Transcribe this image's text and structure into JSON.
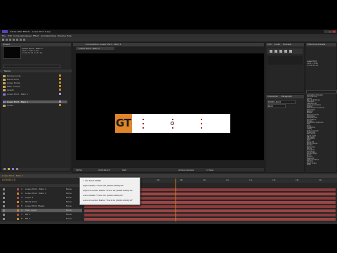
{
  "window": {
    "title": "Adobe After Effects - Lower third 1.aep",
    "controls": [
      "–",
      "□",
      "×"
    ]
  },
  "menu": [
    "File",
    "Edit",
    "Composition",
    "Layer",
    "Effect",
    "Animation",
    "View",
    "Window",
    "Help"
  ],
  "project": {
    "tab": "Project",
    "comp_name": "Lower third - Main 1",
    "comp_info": "1920 x 1080 (1.00)",
    "comp_info2": "Δ 0:00:10:00, 29.97 fps",
    "header": "Name",
    "items": [
      {
        "label": "Backgrounds",
        "selected": false
      },
      {
        "label": "Blank Solid",
        "selected": false
      },
      {
        "label": "Lower thirds",
        "selected": false
      },
      {
        "label": "Main Comps",
        "selected": false
      },
      {
        "label": "Assets",
        "selected": false
      },
      {
        "label": "Lower third - Main 1",
        "selected": false
      },
      {
        "label": "Lower third - Main 1",
        "selected": true
      },
      {
        "label": "Solids",
        "selected": false
      }
    ]
  },
  "composition": {
    "tab": "Composition: Lower third - Main 1",
    "breadcrumb": "Lower third - Main 1",
    "logo_text": "GT",
    "zoom": "(50%)",
    "timecode": "0:00:04:15",
    "resolution": "Half",
    "camera": "Active Camera",
    "view": "1 View"
  },
  "info_panel": {
    "tabs": [
      "Info",
      "Audio",
      "Preview"
    ],
    "label": "Preview"
  },
  "character": {
    "tab": "Character",
    "font": "DINPro-Bold",
    "style": "Bold"
  },
  "paragraph": {
    "tab": "Paragraph"
  },
  "effects": {
    "tab": "Effects & Presets",
    "items": [
      "Animation Presets",
      "3D Channel",
      "Audio",
      "Blur & Sharpen",
      "Channel",
      "CINEMA 4D",
      "Color Correction",
      "Distort",
      "Expression Controls",
      "Generate",
      "Keying",
      "Matte",
      "Noise & Grain",
      "Obsolete",
      "Perspective",
      "Simulation",
      "Stylize",
      "Synthetic Aperture",
      "Text",
      "Time",
      "Transition",
      "Utility",
      "Video Copilot",
      "Trapcode",
      "Red Giant",
      "Knoll Light",
      "RE:Vision",
      "Sapphire",
      "BCC",
      "Boris FX",
      "Magic Bullet",
      "Mocha",
      "Particular",
      "Shine",
      "Starglow",
      "3D Stroke",
      "Sound Keys",
      "Form",
      "Plexus",
      "Element",
      "Optical Flares",
      "Twixtor",
      "Neat Video",
      "Duik"
    ]
  },
  "right_info": {
    "line1": "Lower third",
    "line2": "1920 x 1080",
    "line3": "Δ 0:00:10:00"
  },
  "timeline": {
    "tab": "Lower third - Main 1",
    "timecode": "0:00:04:15",
    "search": "",
    "layers": [
      {
        "num": "1",
        "name": "Lower third - Main 1",
        "parent": "None"
      },
      {
        "num": "2",
        "name": "Lower third - Main 1",
        "parent": "None"
      },
      {
        "num": "3",
        "name": "Layer 3",
        "parent": "None"
      },
      {
        "num": "4",
        "name": "Blank Solid",
        "parent": "None"
      },
      {
        "num": "5",
        "name": "Lower third Shape",
        "parent": "None"
      },
      {
        "num": "6",
        "name": "Main Layer",
        "parent": "None",
        "selected": true
      },
      {
        "num": "7",
        "name": "BG 1",
        "parent": "None"
      },
      {
        "num": "8",
        "name": "BG 2",
        "parent": "None"
      }
    ],
    "ticks": [
      "0s",
      "02s",
      "04s",
      "06s",
      "08s",
      "10s",
      "12s",
      "14s",
      "16s",
      "18s",
      "20s"
    ]
  },
  "context_menu": {
    "items": [
      "No Track Matte",
      "Alpha Matte \"Track 02 [0000-0000].tif\"",
      "Alpha Inverted Matte \"Track 02 [0000-0000].tif\"",
      "Luma Matte \"Track 02 [0000-0000].tif\"",
      "Luma Inverted Matte \"Track 02 [0000-0000].tif\""
    ]
  },
  "colors": {
    "accent": "#e0852a",
    "timeline_bar": "#8c3a3a",
    "panel_bg": "#262626",
    "selection": "#5b5b5b"
  }
}
